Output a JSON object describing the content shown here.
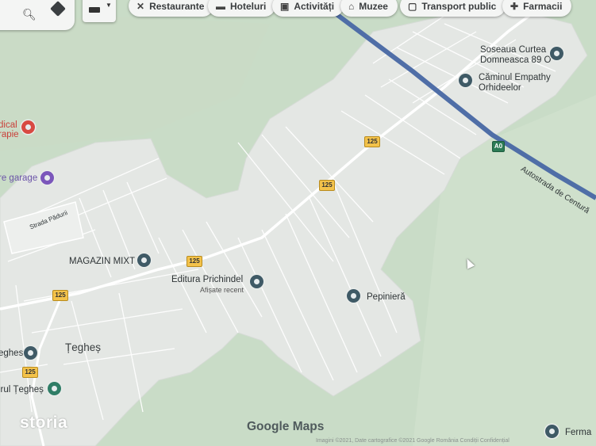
{
  "toolbar": {
    "chips": [
      {
        "label": "Restaurante",
        "icon": "fork-knife-icon"
      },
      {
        "label": "Hoteluri",
        "icon": "bed-icon"
      },
      {
        "label": "Activități",
        "icon": "camera-icon"
      },
      {
        "label": "Muzee",
        "icon": "museum-icon"
      },
      {
        "label": "Transport public",
        "icon": "bus-icon"
      },
      {
        "label": "Farmacii",
        "icon": "pharmacy-icon"
      }
    ]
  },
  "places": {
    "soseaua_line1": "Soseaua Curtea",
    "soseaua_line2": "Domneasca 89 O",
    "camin_line1": "Căminul Empathy",
    "camin_line2": "Orhideelor",
    "medical_line1": "dical",
    "medical_line2": "rapie",
    "garage": "re garage",
    "strada": "Strada Pădurii",
    "magazin": "MAGAZIN MIXT",
    "editura": "Editura Prichindel",
    "editura_sub": "Afișate recent",
    "pepiniera": "Pepinieră",
    "teghes": "Țegheș",
    "eghes": "eghes",
    "irul": "irul Țegheș",
    "autostrada": "Autostrada de Centură",
    "ferma": "Ferma"
  },
  "road_shields": {
    "route_125": "125",
    "route_a0": "A0"
  },
  "branding": {
    "storia": "storia",
    "google_maps": "Google Maps",
    "footer": "Imagini ©2021, Date cartografice ©2021 Google   România   Condiții   Confidențial"
  },
  "colors": {
    "map_green": "#c9dcc7",
    "urban_gray": "#e4e7e4",
    "motorway": "#4f6ea7",
    "road": "#ffffff",
    "route_shield": "#f3c24a"
  }
}
